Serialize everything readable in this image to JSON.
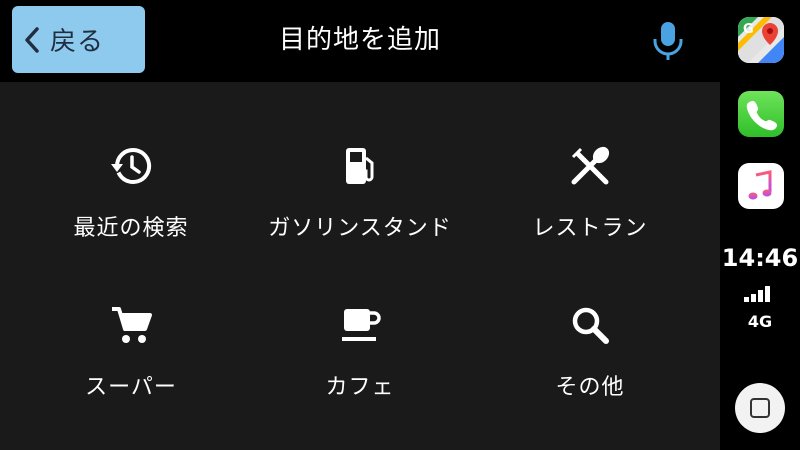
{
  "header": {
    "back_label": "戻る",
    "title": "目的地を追加",
    "mic_icon": "microphone-icon"
  },
  "categories": [
    {
      "label": "最近の検索",
      "icon": "history-icon"
    },
    {
      "label": "ガソリンスタンド",
      "icon": "gas-station-icon"
    },
    {
      "label": "レストラン",
      "icon": "restaurant-icon"
    },
    {
      "label": "スーパー",
      "icon": "shopping-cart-icon"
    },
    {
      "label": "カフェ",
      "icon": "coffee-cup-icon"
    },
    {
      "label": "その他",
      "icon": "search-icon"
    }
  ],
  "sidebar": {
    "apps": [
      "google-maps-icon",
      "phone-icon",
      "music-icon"
    ],
    "time": "14:46",
    "network": "4G",
    "signal_bars": 4
  },
  "colors": {
    "back_button": "#8ec9ee",
    "mic": "#4aa3e0",
    "main_bg": "#1a1a1a"
  }
}
